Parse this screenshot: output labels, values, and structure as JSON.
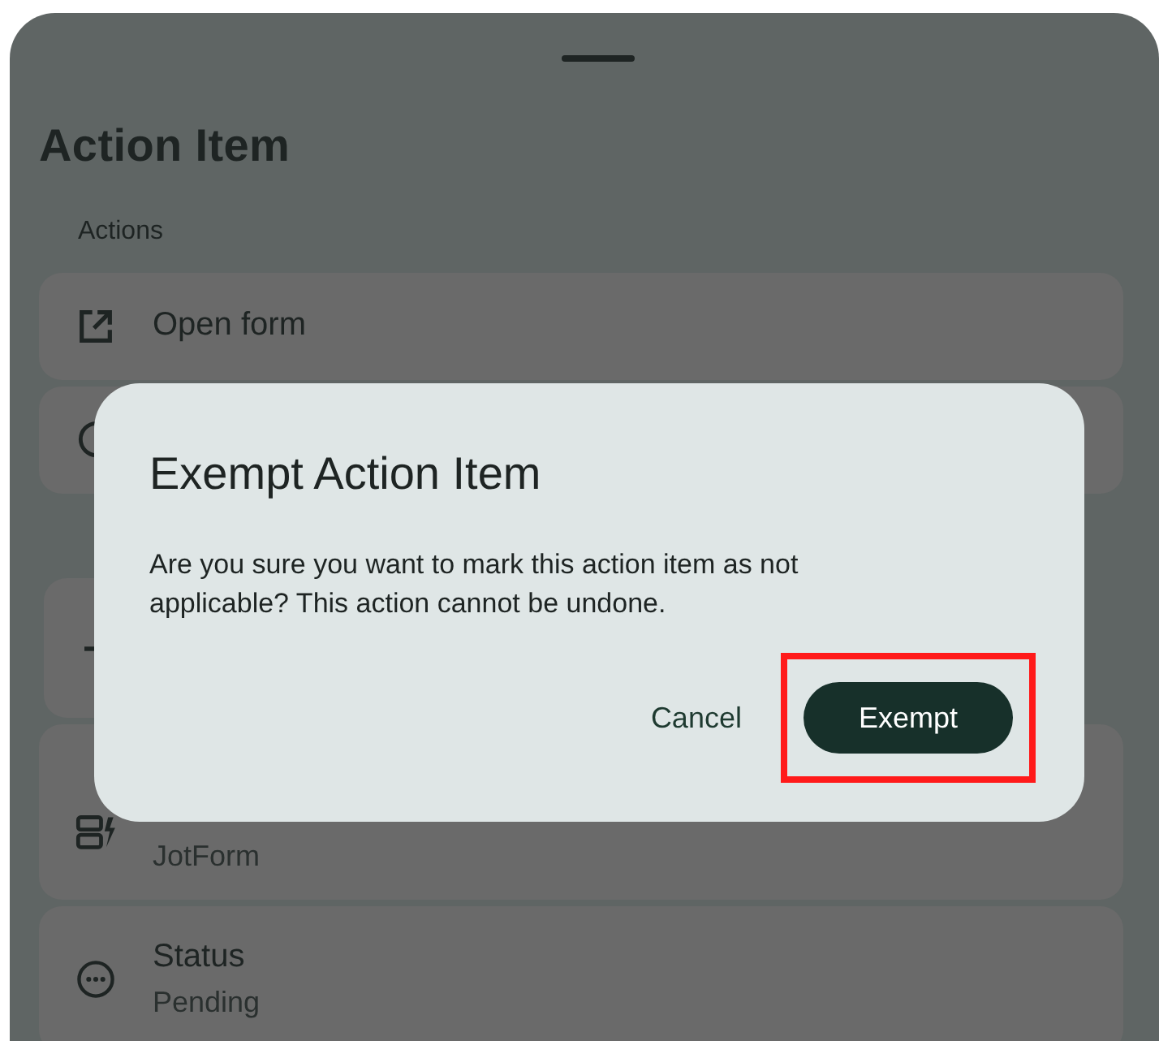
{
  "sheet": {
    "title": "Action Item",
    "section_label": "Actions",
    "actions": [
      {
        "kind": "open",
        "label": "Open form"
      },
      {
        "kind": "circle"
      }
    ],
    "info": [
      {
        "kind": "dash"
      },
      {
        "kind": "type",
        "value": "JotForm"
      },
      {
        "kind": "status",
        "label": "Status",
        "value": "Pending"
      }
    ]
  },
  "dialog": {
    "title": "Exempt Action Item",
    "message": "Are you sure you want to mark this action item as not applicable? This action cannot be undone.",
    "buttons": [
      {
        "label": "Cancel",
        "kind": "text",
        "highlighted": false
      },
      {
        "label": "Exempt",
        "kind": "filled",
        "highlighted": true
      }
    ]
  }
}
